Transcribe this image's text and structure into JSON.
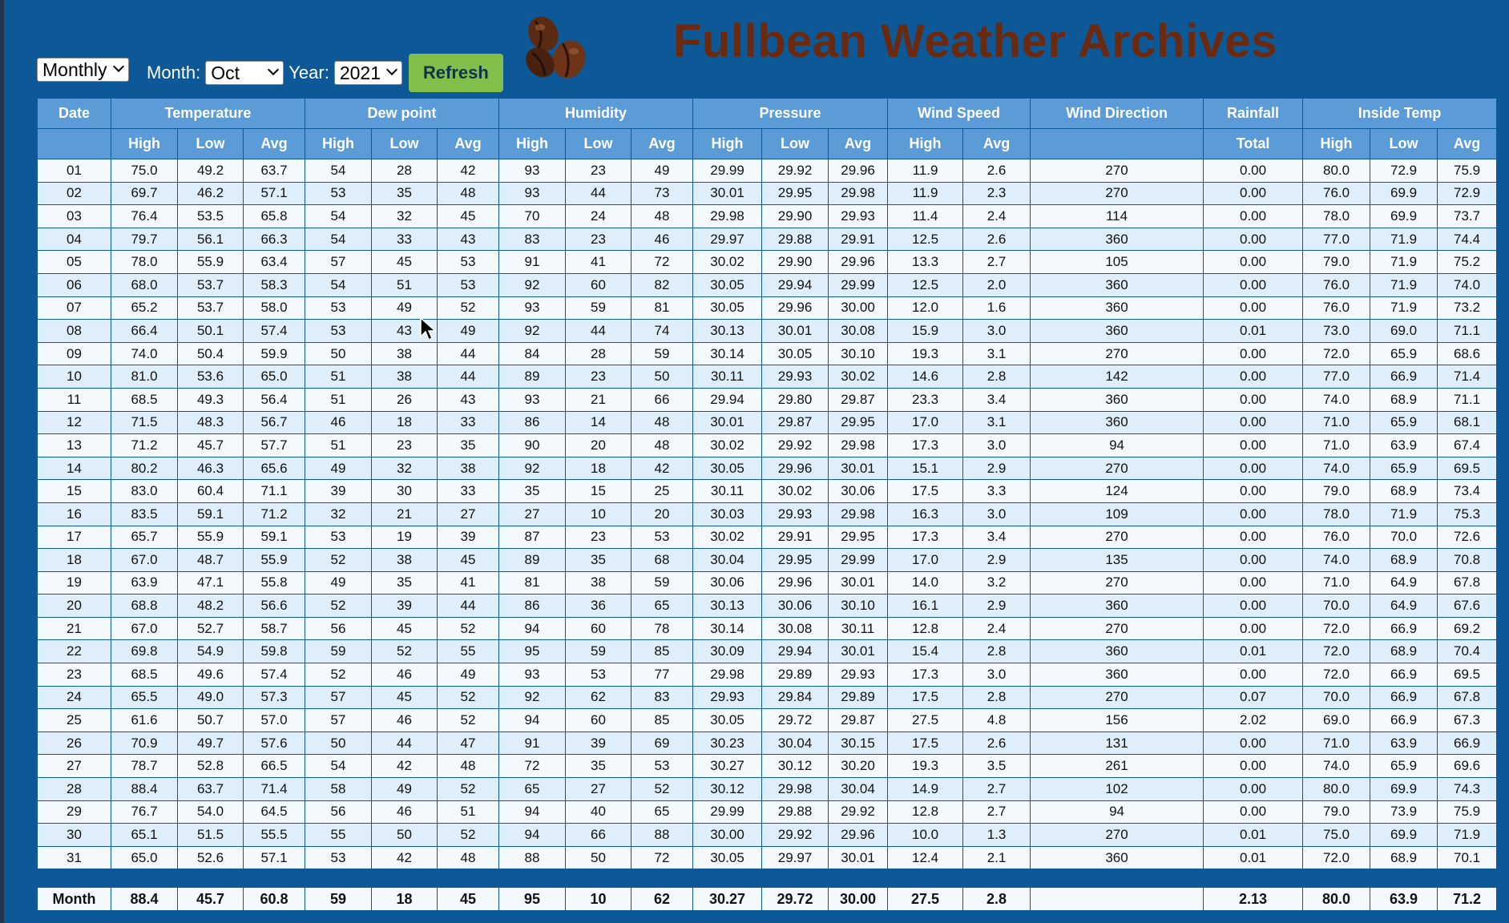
{
  "header": {
    "title": "Fullbean Weather Archives",
    "period_select": "Monthly",
    "month_label": "Month:",
    "month_value": "Oct",
    "year_label": "Year:",
    "year_value": "2021",
    "refresh_label": "Refresh",
    "logo_icon": "coffee-beans-icon"
  },
  "table": {
    "group_headers": [
      "Date",
      "Temperature",
      "Dew point",
      "Humidity",
      "Pressure",
      "Wind Speed",
      "Wind Direction",
      "Rainfall",
      "Inside Temp"
    ],
    "sub_headers": [
      "",
      "High",
      "Low",
      "Avg",
      "High",
      "Low",
      "Avg",
      "High",
      "Low",
      "Avg",
      "High",
      "Low",
      "Avg",
      "High",
      "Avg",
      "",
      "Total",
      "High",
      "Low",
      "Avg"
    ],
    "rows": [
      [
        "01",
        "75.0",
        "49.2",
        "63.7",
        "54",
        "28",
        "42",
        "93",
        "23",
        "49",
        "29.99",
        "29.92",
        "29.96",
        "11.9",
        "2.6",
        "270",
        "0.00",
        "80.0",
        "72.9",
        "75.9"
      ],
      [
        "02",
        "69.7",
        "46.2",
        "57.1",
        "53",
        "35",
        "48",
        "93",
        "44",
        "73",
        "30.01",
        "29.95",
        "29.98",
        "11.9",
        "2.3",
        "270",
        "0.00",
        "76.0",
        "69.9",
        "72.9"
      ],
      [
        "03",
        "76.4",
        "53.5",
        "65.8",
        "54",
        "32",
        "45",
        "70",
        "24",
        "48",
        "29.98",
        "29.90",
        "29.93",
        "11.4",
        "2.4",
        "114",
        "0.00",
        "78.0",
        "69.9",
        "73.7"
      ],
      [
        "04",
        "79.7",
        "56.1",
        "66.3",
        "54",
        "33",
        "43",
        "83",
        "23",
        "46",
        "29.97",
        "29.88",
        "29.91",
        "12.5",
        "2.6",
        "360",
        "0.00",
        "77.0",
        "71.9",
        "74.4"
      ],
      [
        "05",
        "78.0",
        "55.9",
        "63.4",
        "57",
        "45",
        "53",
        "91",
        "41",
        "72",
        "30.02",
        "29.90",
        "29.96",
        "13.3",
        "2.7",
        "105",
        "0.00",
        "79.0",
        "71.9",
        "75.2"
      ],
      [
        "06",
        "68.0",
        "53.7",
        "58.3",
        "54",
        "51",
        "53",
        "92",
        "60",
        "82",
        "30.05",
        "29.94",
        "29.99",
        "12.5",
        "2.0",
        "360",
        "0.00",
        "76.0",
        "71.9",
        "74.0"
      ],
      [
        "07",
        "65.2",
        "53.7",
        "58.0",
        "53",
        "49",
        "52",
        "93",
        "59",
        "81",
        "30.05",
        "29.96",
        "30.00",
        "12.0",
        "1.6",
        "360",
        "0.00",
        "76.0",
        "71.9",
        "73.2"
      ],
      [
        "08",
        "66.4",
        "50.1",
        "57.4",
        "53",
        "43",
        "49",
        "92",
        "44",
        "74",
        "30.13",
        "30.01",
        "30.08",
        "15.9",
        "3.0",
        "360",
        "0.01",
        "73.0",
        "69.0",
        "71.1"
      ],
      [
        "09",
        "74.0",
        "50.4",
        "59.9",
        "50",
        "38",
        "44",
        "84",
        "28",
        "59",
        "30.14",
        "30.05",
        "30.10",
        "19.3",
        "3.1",
        "270",
        "0.00",
        "72.0",
        "65.9",
        "68.6"
      ],
      [
        "10",
        "81.0",
        "53.6",
        "65.0",
        "51",
        "38",
        "44",
        "89",
        "23",
        "50",
        "30.11",
        "29.93",
        "30.02",
        "14.6",
        "2.8",
        "142",
        "0.00",
        "77.0",
        "66.9",
        "71.4"
      ],
      [
        "11",
        "68.5",
        "49.3",
        "56.4",
        "51",
        "26",
        "43",
        "93",
        "21",
        "66",
        "29.94",
        "29.80",
        "29.87",
        "23.3",
        "3.4",
        "360",
        "0.00",
        "74.0",
        "68.9",
        "71.1"
      ],
      [
        "12",
        "71.5",
        "48.3",
        "56.7",
        "46",
        "18",
        "33",
        "86",
        "14",
        "48",
        "30.01",
        "29.87",
        "29.95",
        "17.0",
        "3.1",
        "360",
        "0.00",
        "71.0",
        "65.9",
        "68.1"
      ],
      [
        "13",
        "71.2",
        "45.7",
        "57.7",
        "51",
        "23",
        "35",
        "90",
        "20",
        "48",
        "30.02",
        "29.92",
        "29.98",
        "17.3",
        "3.0",
        "94",
        "0.00",
        "71.0",
        "63.9",
        "67.4"
      ],
      [
        "14",
        "80.2",
        "46.3",
        "65.6",
        "49",
        "32",
        "38",
        "92",
        "18",
        "42",
        "30.05",
        "29.96",
        "30.01",
        "15.1",
        "2.9",
        "270",
        "0.00",
        "74.0",
        "65.9",
        "69.5"
      ],
      [
        "15",
        "83.0",
        "60.4",
        "71.1",
        "39",
        "30",
        "33",
        "35",
        "15",
        "25",
        "30.11",
        "30.02",
        "30.06",
        "17.5",
        "3.3",
        "124",
        "0.00",
        "79.0",
        "68.9",
        "73.4"
      ],
      [
        "16",
        "83.5",
        "59.1",
        "71.2",
        "32",
        "21",
        "27",
        "27",
        "10",
        "20",
        "30.03",
        "29.93",
        "29.98",
        "16.3",
        "3.0",
        "109",
        "0.00",
        "78.0",
        "71.9",
        "75.3"
      ],
      [
        "17",
        "65.7",
        "55.9",
        "59.1",
        "53",
        "19",
        "39",
        "87",
        "23",
        "53",
        "30.02",
        "29.91",
        "29.95",
        "17.3",
        "3.4",
        "270",
        "0.00",
        "76.0",
        "70.0",
        "72.6"
      ],
      [
        "18",
        "67.0",
        "48.7",
        "55.9",
        "52",
        "38",
        "45",
        "89",
        "35",
        "68",
        "30.04",
        "29.95",
        "29.99",
        "17.0",
        "2.9",
        "135",
        "0.00",
        "74.0",
        "68.9",
        "70.8"
      ],
      [
        "19",
        "63.9",
        "47.1",
        "55.8",
        "49",
        "35",
        "41",
        "81",
        "38",
        "59",
        "30.06",
        "29.96",
        "30.01",
        "14.0",
        "3.2",
        "270",
        "0.00",
        "71.0",
        "64.9",
        "67.8"
      ],
      [
        "20",
        "68.8",
        "48.2",
        "56.6",
        "52",
        "39",
        "44",
        "86",
        "36",
        "65",
        "30.13",
        "30.06",
        "30.10",
        "16.1",
        "2.9",
        "360",
        "0.00",
        "70.0",
        "64.9",
        "67.6"
      ],
      [
        "21",
        "67.0",
        "52.7",
        "58.7",
        "56",
        "45",
        "52",
        "94",
        "60",
        "78",
        "30.14",
        "30.08",
        "30.11",
        "12.8",
        "2.4",
        "270",
        "0.00",
        "72.0",
        "66.9",
        "69.2"
      ],
      [
        "22",
        "69.8",
        "54.9",
        "59.8",
        "59",
        "52",
        "55",
        "95",
        "59",
        "85",
        "30.09",
        "29.94",
        "30.01",
        "15.4",
        "2.8",
        "360",
        "0.01",
        "72.0",
        "68.9",
        "70.4"
      ],
      [
        "23",
        "68.5",
        "49.6",
        "57.4",
        "52",
        "46",
        "49",
        "93",
        "53",
        "77",
        "29.98",
        "29.89",
        "29.93",
        "17.3",
        "3.0",
        "360",
        "0.00",
        "72.0",
        "66.9",
        "69.5"
      ],
      [
        "24",
        "65.5",
        "49.0",
        "57.3",
        "57",
        "45",
        "52",
        "92",
        "62",
        "83",
        "29.93",
        "29.84",
        "29.89",
        "17.5",
        "2.8",
        "270",
        "0.07",
        "70.0",
        "66.9",
        "67.8"
      ],
      [
        "25",
        "61.6",
        "50.7",
        "57.0",
        "57",
        "46",
        "52",
        "94",
        "60",
        "85",
        "30.05",
        "29.72",
        "29.87",
        "27.5",
        "4.8",
        "156",
        "2.02",
        "69.0",
        "66.9",
        "67.3"
      ],
      [
        "26",
        "70.9",
        "49.7",
        "57.6",
        "50",
        "44",
        "47",
        "91",
        "39",
        "69",
        "30.23",
        "30.04",
        "30.15",
        "17.5",
        "2.6",
        "131",
        "0.00",
        "71.0",
        "63.9",
        "66.9"
      ],
      [
        "27",
        "78.7",
        "52.8",
        "66.5",
        "54",
        "42",
        "48",
        "72",
        "35",
        "53",
        "30.27",
        "30.12",
        "30.20",
        "19.3",
        "3.5",
        "261",
        "0.00",
        "74.0",
        "65.9",
        "69.6"
      ],
      [
        "28",
        "88.4",
        "63.7",
        "71.4",
        "58",
        "49",
        "52",
        "65",
        "27",
        "52",
        "30.12",
        "29.98",
        "30.04",
        "14.9",
        "2.7",
        "102",
        "0.00",
        "80.0",
        "69.9",
        "74.3"
      ],
      [
        "29",
        "76.7",
        "54.0",
        "64.5",
        "56",
        "46",
        "51",
        "94",
        "40",
        "65",
        "29.99",
        "29.88",
        "29.92",
        "12.8",
        "2.7",
        "94",
        "0.00",
        "79.0",
        "73.9",
        "75.9"
      ],
      [
        "30",
        "65.1",
        "51.5",
        "55.5",
        "55",
        "50",
        "52",
        "94",
        "66",
        "88",
        "30.00",
        "29.92",
        "29.96",
        "10.0",
        "1.3",
        "270",
        "0.01",
        "75.0",
        "69.9",
        "71.9"
      ],
      [
        "31",
        "65.0",
        "52.6",
        "57.1",
        "53",
        "42",
        "48",
        "88",
        "50",
        "72",
        "30.05",
        "29.97",
        "30.01",
        "12.4",
        "2.1",
        "360",
        "0.01",
        "72.0",
        "68.9",
        "70.1"
      ]
    ],
    "footer": [
      "Month",
      "88.4",
      "45.7",
      "60.8",
      "59",
      "18",
      "45",
      "95",
      "10",
      "62",
      "30.27",
      "29.72",
      "30.00",
      "27.5",
      "2.8",
      "",
      "2.13",
      "80.0",
      "63.9",
      "71.2"
    ]
  }
}
